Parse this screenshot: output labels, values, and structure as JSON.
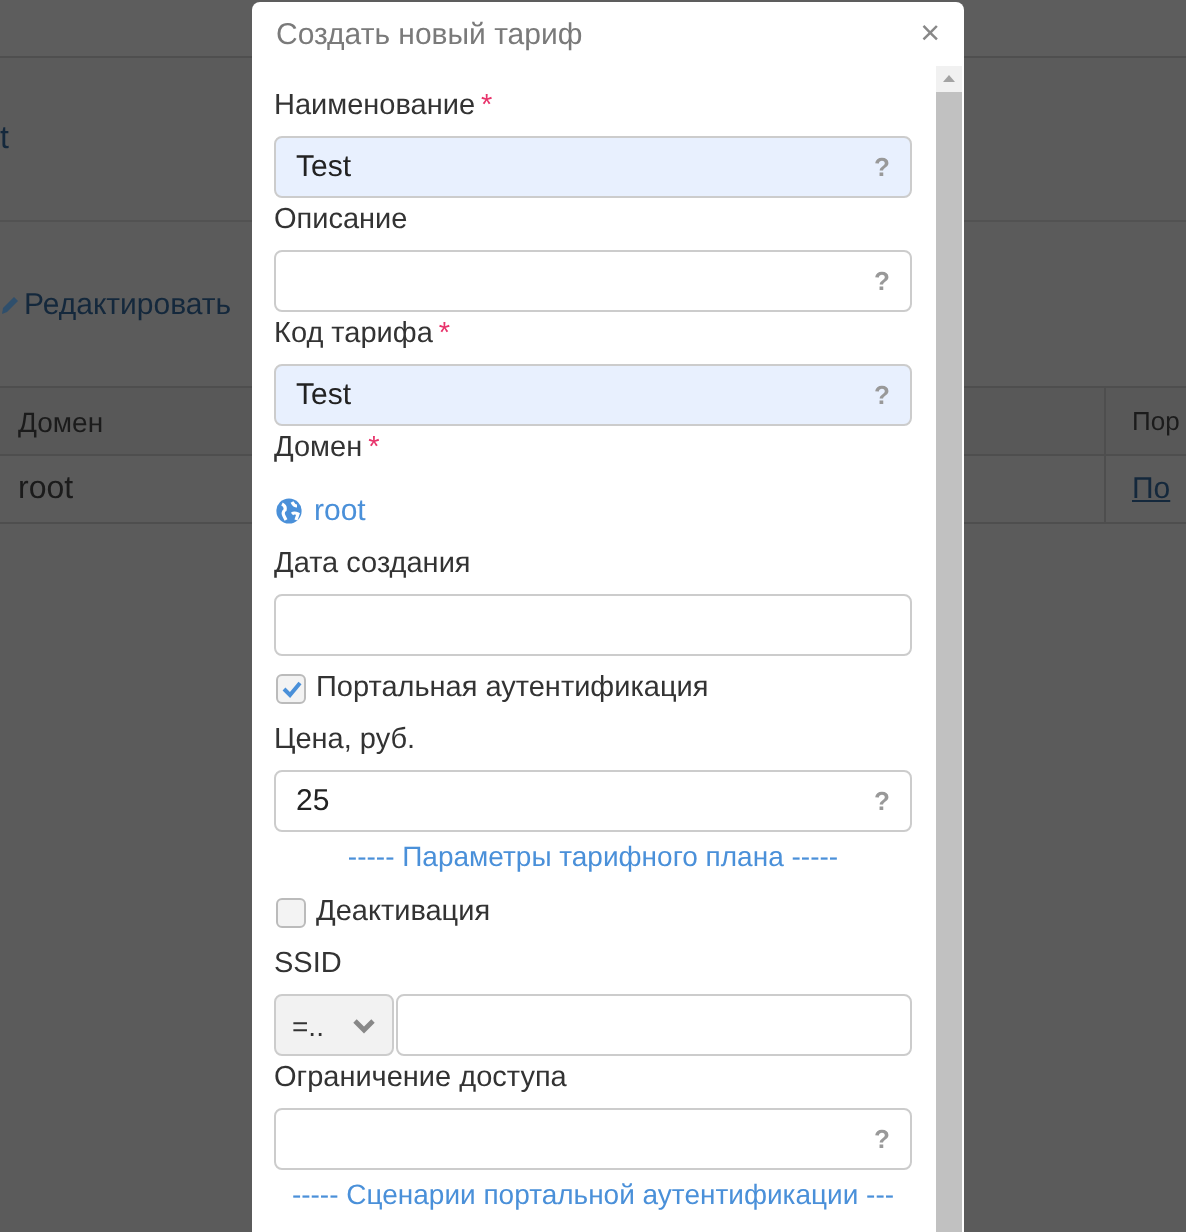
{
  "background": {
    "link": "t",
    "edit_button": "Редактировать",
    "table": {
      "columns": [
        "Домен",
        "Пор"
      ],
      "rows": [
        [
          "root",
          "По"
        ]
      ]
    }
  },
  "dialog": {
    "title": "Создать новый тариф",
    "close": "×",
    "fields": [
      {
        "kind": "input",
        "label": "Наименование",
        "required_mark": "*",
        "value": "Test",
        "help": "?",
        "autofilled": true
      },
      {
        "kind": "input",
        "label": "Описание",
        "help": "?",
        "autofilled": false
      },
      {
        "kind": "input",
        "label": "Код тарифа",
        "required_mark": "*",
        "value": "Test",
        "help": "?",
        "autofilled": true
      },
      {
        "kind": "domain",
        "label": "Домен",
        "required_mark": "*",
        "value": "root"
      },
      {
        "kind": "input",
        "label": "Дата создания",
        "autofilled": false
      },
      {
        "kind": "checkbox",
        "label": "Портальная аутентификация",
        "checked": true
      },
      {
        "kind": "input",
        "label": "Цена, руб.",
        "value": "25",
        "help": "?",
        "autofilled": false
      },
      {
        "kind": "separator",
        "label": "----- Параметры тарифного плана -----"
      },
      {
        "kind": "checkbox",
        "label": "Деактивация",
        "checked": false
      },
      {
        "kind": "select_input",
        "label": "SSID",
        "select": "=.."
      },
      {
        "kind": "input",
        "label": "Ограничение доступа",
        "help": "?",
        "autofilled": false
      },
      {
        "kind": "separator",
        "label": "----- Сценарии портальной аутентификации ---"
      }
    ]
  }
}
